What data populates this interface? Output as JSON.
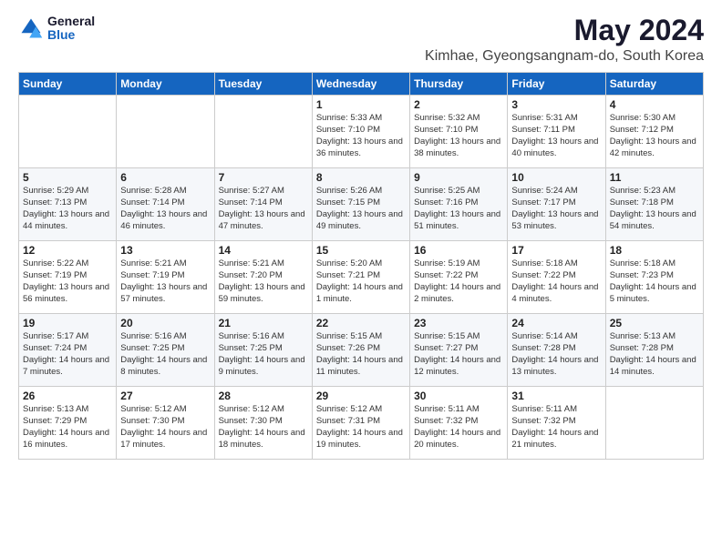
{
  "logo": {
    "general": "General",
    "blue": "Blue"
  },
  "title": "May 2024",
  "subtitle": "Kimhae, Gyeongsangnam-do, South Korea",
  "days_of_week": [
    "Sunday",
    "Monday",
    "Tuesday",
    "Wednesday",
    "Thursday",
    "Friday",
    "Saturday"
  ],
  "weeks": [
    [
      {
        "day": "",
        "info": ""
      },
      {
        "day": "",
        "info": ""
      },
      {
        "day": "",
        "info": ""
      },
      {
        "day": "1",
        "info": "Sunrise: 5:33 AM\nSunset: 7:10 PM\nDaylight: 13 hours and 36 minutes."
      },
      {
        "day": "2",
        "info": "Sunrise: 5:32 AM\nSunset: 7:10 PM\nDaylight: 13 hours and 38 minutes."
      },
      {
        "day": "3",
        "info": "Sunrise: 5:31 AM\nSunset: 7:11 PM\nDaylight: 13 hours and 40 minutes."
      },
      {
        "day": "4",
        "info": "Sunrise: 5:30 AM\nSunset: 7:12 PM\nDaylight: 13 hours and 42 minutes."
      }
    ],
    [
      {
        "day": "5",
        "info": "Sunrise: 5:29 AM\nSunset: 7:13 PM\nDaylight: 13 hours and 44 minutes."
      },
      {
        "day": "6",
        "info": "Sunrise: 5:28 AM\nSunset: 7:14 PM\nDaylight: 13 hours and 46 minutes."
      },
      {
        "day": "7",
        "info": "Sunrise: 5:27 AM\nSunset: 7:14 PM\nDaylight: 13 hours and 47 minutes."
      },
      {
        "day": "8",
        "info": "Sunrise: 5:26 AM\nSunset: 7:15 PM\nDaylight: 13 hours and 49 minutes."
      },
      {
        "day": "9",
        "info": "Sunrise: 5:25 AM\nSunset: 7:16 PM\nDaylight: 13 hours and 51 minutes."
      },
      {
        "day": "10",
        "info": "Sunrise: 5:24 AM\nSunset: 7:17 PM\nDaylight: 13 hours and 53 minutes."
      },
      {
        "day": "11",
        "info": "Sunrise: 5:23 AM\nSunset: 7:18 PM\nDaylight: 13 hours and 54 minutes."
      }
    ],
    [
      {
        "day": "12",
        "info": "Sunrise: 5:22 AM\nSunset: 7:19 PM\nDaylight: 13 hours and 56 minutes."
      },
      {
        "day": "13",
        "info": "Sunrise: 5:21 AM\nSunset: 7:19 PM\nDaylight: 13 hours and 57 minutes."
      },
      {
        "day": "14",
        "info": "Sunrise: 5:21 AM\nSunset: 7:20 PM\nDaylight: 13 hours and 59 minutes."
      },
      {
        "day": "15",
        "info": "Sunrise: 5:20 AM\nSunset: 7:21 PM\nDaylight: 14 hours and 1 minute."
      },
      {
        "day": "16",
        "info": "Sunrise: 5:19 AM\nSunset: 7:22 PM\nDaylight: 14 hours and 2 minutes."
      },
      {
        "day": "17",
        "info": "Sunrise: 5:18 AM\nSunset: 7:22 PM\nDaylight: 14 hours and 4 minutes."
      },
      {
        "day": "18",
        "info": "Sunrise: 5:18 AM\nSunset: 7:23 PM\nDaylight: 14 hours and 5 minutes."
      }
    ],
    [
      {
        "day": "19",
        "info": "Sunrise: 5:17 AM\nSunset: 7:24 PM\nDaylight: 14 hours and 7 minutes."
      },
      {
        "day": "20",
        "info": "Sunrise: 5:16 AM\nSunset: 7:25 PM\nDaylight: 14 hours and 8 minutes."
      },
      {
        "day": "21",
        "info": "Sunrise: 5:16 AM\nSunset: 7:25 PM\nDaylight: 14 hours and 9 minutes."
      },
      {
        "day": "22",
        "info": "Sunrise: 5:15 AM\nSunset: 7:26 PM\nDaylight: 14 hours and 11 minutes."
      },
      {
        "day": "23",
        "info": "Sunrise: 5:15 AM\nSunset: 7:27 PM\nDaylight: 14 hours and 12 minutes."
      },
      {
        "day": "24",
        "info": "Sunrise: 5:14 AM\nSunset: 7:28 PM\nDaylight: 14 hours and 13 minutes."
      },
      {
        "day": "25",
        "info": "Sunrise: 5:13 AM\nSunset: 7:28 PM\nDaylight: 14 hours and 14 minutes."
      }
    ],
    [
      {
        "day": "26",
        "info": "Sunrise: 5:13 AM\nSunset: 7:29 PM\nDaylight: 14 hours and 16 minutes."
      },
      {
        "day": "27",
        "info": "Sunrise: 5:12 AM\nSunset: 7:30 PM\nDaylight: 14 hours and 17 minutes."
      },
      {
        "day": "28",
        "info": "Sunrise: 5:12 AM\nSunset: 7:30 PM\nDaylight: 14 hours and 18 minutes."
      },
      {
        "day": "29",
        "info": "Sunrise: 5:12 AM\nSunset: 7:31 PM\nDaylight: 14 hours and 19 minutes."
      },
      {
        "day": "30",
        "info": "Sunrise: 5:11 AM\nSunset: 7:32 PM\nDaylight: 14 hours and 20 minutes."
      },
      {
        "day": "31",
        "info": "Sunrise: 5:11 AM\nSunset: 7:32 PM\nDaylight: 14 hours and 21 minutes."
      },
      {
        "day": "",
        "info": ""
      }
    ]
  ]
}
